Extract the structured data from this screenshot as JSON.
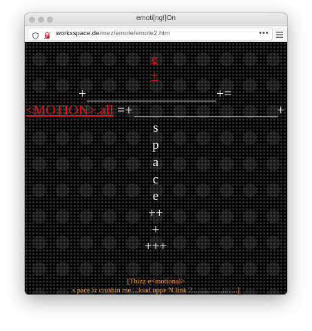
{
  "window": {
    "title": "emoti[ng!]On"
  },
  "toolbar": {
    "url_host": "workxspace.de",
    "url_path": "/mez/emote/emote2.htm",
    "more_label": "•••"
  },
  "page": {
    "link_e": "e",
    "link_plus": "+",
    "plus_left": "+",
    "plus_eq": "+=",
    "motion_link": "<MOTION>.all",
    "eq_plus": "=+",
    "plus_right": "+",
    "letters": [
      "s",
      "p",
      "a",
      "c",
      "e"
    ],
    "plus_plus": "++",
    "plus_one": "+",
    "plus_three": "+++",
    "caption_line1": "[Thizz e<motional>",
    "caption_line2": "s pace iz crushin me....load uppe N link 2.........................]"
  },
  "colors": {
    "red": "#e0151a",
    "orange": "#ff9b2a",
    "background": "#000000"
  }
}
